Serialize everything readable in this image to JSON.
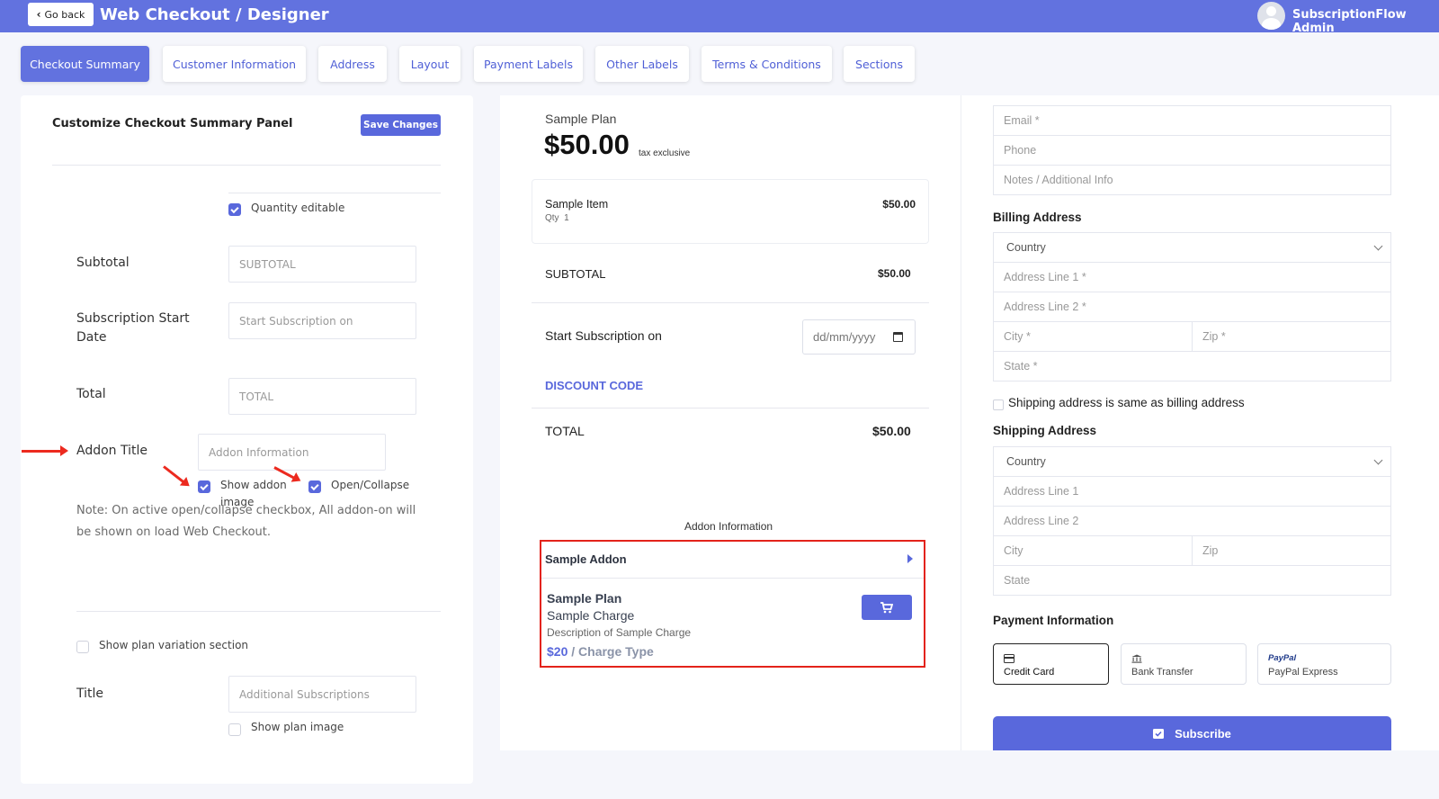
{
  "header": {
    "go_back": "Go back",
    "title": "Web Checkout / Designer",
    "admin_name": "SubscriptionFlow Admin"
  },
  "tabs": [
    {
      "label": "Checkout Summary",
      "active": true
    },
    {
      "label": "Customer Information",
      "active": false
    },
    {
      "label": "Address",
      "active": false
    },
    {
      "label": "Layout",
      "active": false
    },
    {
      "label": "Payment Labels",
      "active": false
    },
    {
      "label": "Other Labels",
      "active": false
    },
    {
      "label": "Terms & Conditions",
      "active": false
    },
    {
      "label": "Sections",
      "active": false
    }
  ],
  "left_panel": {
    "title": "Customize Checkout Summary Panel",
    "save_label": "Save Changes",
    "quantity_editable": "Quantity editable",
    "subtotal_label": "Subtotal",
    "subtotal_value": "SUBTOTAL",
    "start_date_label_1": "Subscription Start",
    "start_date_label_2": "Date",
    "start_date_value": "Start Subscription on",
    "total_label": "Total",
    "total_value": "TOTAL",
    "addon_title_label": "Addon Title",
    "addon_title_value": "Addon Information",
    "show_addon_image_1": "Show addon",
    "show_addon_image_2": "image",
    "open_collapse": "Open/Collapse",
    "note_1": "Note: On active open/collapse checkbox, All addon-on will",
    "note_2": "be shown on load Web Checkout.",
    "show_plan_variation": "Show plan variation section",
    "title_label": "Title",
    "title_value": "Additional Subscriptions",
    "show_plan_image": "Show plan image"
  },
  "preview": {
    "plan_name": "Sample Plan",
    "price": "$50.00",
    "tax_note": "tax exclusive",
    "item_name": "Sample Item",
    "item_qty_label": "Qty",
    "item_qty": "1",
    "item_price": "$50.00",
    "subtotal_label": "SUBTOTAL",
    "subtotal_value": "$50.00",
    "start_label": "Start Subscription on",
    "date_placeholder": "dd/mm/yyyy",
    "discount_label": "DISCOUNT CODE",
    "total_label": "TOTAL",
    "total_value": "$50.00",
    "addon_info_title": "Addon Information",
    "addon_name": "Sample Addon",
    "addon_plan": "Sample Plan",
    "addon_charge": "Sample Charge",
    "addon_desc": "Description of Sample Charge",
    "addon_price": "$20",
    "addon_charge_type": "/ Charge Type"
  },
  "form": {
    "email": "Email *",
    "phone": "Phone",
    "notes": "Notes / Additional Info",
    "billing_heading": "Billing Address",
    "billing_country": "Country",
    "billing_address1": "Address Line 1 *",
    "billing_address2": "Address Line 2 *",
    "billing_city": "City *",
    "billing_zip": "Zip *",
    "billing_state": "State *",
    "same_address": "Shipping address is same as billing address",
    "shipping_heading": "Shipping Address",
    "shipping_country": "Country",
    "shipping_address1": "Address Line 1",
    "shipping_address2": "Address Line 2",
    "shipping_city": "City",
    "shipping_zip": "Zip",
    "shipping_state": "State",
    "payment_heading": "Payment Information",
    "payment_credit": "Credit Card",
    "payment_bank": "Bank Transfer",
    "paypal_logo": "PayPal",
    "payment_paypal": "PayPal Express",
    "subscribe": "Subscribe"
  },
  "colors": {
    "brand": "#6272df",
    "button": "#5968dc",
    "highlight": "#e3231b"
  }
}
